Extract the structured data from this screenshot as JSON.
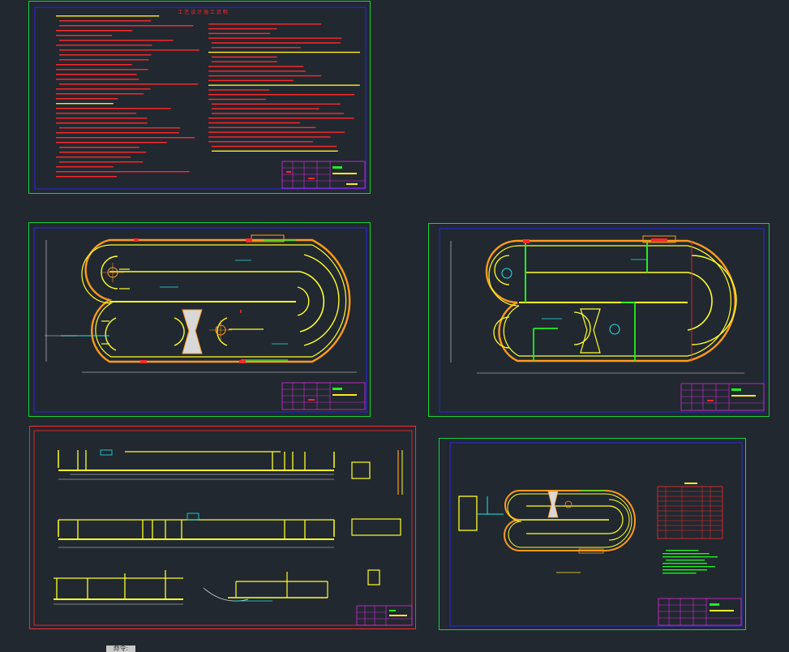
{
  "canvas": {
    "background": "#212830"
  },
  "colors": {
    "green_frame": "#19d23a",
    "red_frame": "#ff2a2a",
    "blue_frame": "#2828e6",
    "wall_yellow": "#ffff2a",
    "wall_orange": "#ff9a1e",
    "text_red": "#ff2a2a",
    "text_yellow": "#ffe82a",
    "accent_cyan": "#22e6e6",
    "accent_magenta": "#e028e0",
    "note_green": "#22ee22",
    "dim_white": "#dddddd"
  },
  "sheets": [
    {
      "id": "design-notes",
      "kind": "notes",
      "frame": "green",
      "title": "工 艺 设 计 施 工 说 明"
    },
    {
      "id": "plan-1",
      "kind": "plan-oval",
      "frame": "green"
    },
    {
      "id": "plan-2",
      "kind": "plan-oval-partitioned",
      "frame": "green"
    },
    {
      "id": "sections",
      "kind": "sections",
      "frame": "red"
    },
    {
      "id": "plan-small",
      "kind": "plan-small-with-table",
      "frame": "green"
    }
  ],
  "command_line": {
    "label": "命令:"
  }
}
